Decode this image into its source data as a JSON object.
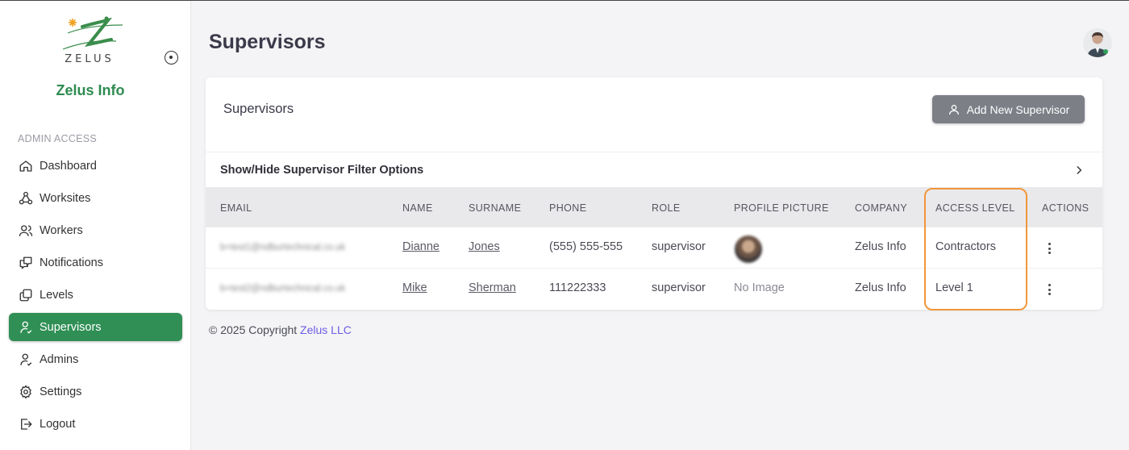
{
  "brand": {
    "logo_text": "ZELUS",
    "name": "Zelus Info"
  },
  "sidebar": {
    "section_label": "ADMIN ACCESS",
    "items": [
      {
        "label": "Dashboard",
        "icon": "home-icon"
      },
      {
        "label": "Worksites",
        "icon": "sitemap-icon"
      },
      {
        "label": "Workers",
        "icon": "users-icon"
      },
      {
        "label": "Notifications",
        "icon": "chat-icon"
      },
      {
        "label": "Levels",
        "icon": "copy-icon"
      },
      {
        "label": "Supervisors",
        "icon": "user-check-icon",
        "active": true
      },
      {
        "label": "Admins",
        "icon": "user-check-icon"
      },
      {
        "label": "Settings",
        "icon": "gear-icon"
      },
      {
        "label": "Logout",
        "icon": "logout-icon"
      }
    ]
  },
  "header": {
    "title": "Supervisors"
  },
  "card": {
    "title": "Supervisors",
    "add_button": "Add New Supervisor",
    "filter_toggle": "Show/Hide Supervisor Filter Options"
  },
  "table": {
    "columns": [
      "EMAIL",
      "NAME",
      "SURNAME",
      "PHONE",
      "ROLE",
      "PROFILE PICTURE",
      "COMPANY",
      "ACCESS LEVEL",
      "ACTIONS"
    ],
    "rows": [
      {
        "email": "b+test1@ndburtechnical.co.uk",
        "name": "Dianne",
        "surname": "Jones",
        "phone": "(555) 555-555",
        "role": "supervisor",
        "picture": "",
        "company": "Zelus Info",
        "access_level": "Contractors"
      },
      {
        "email": "b+test2@ndburtechnical.co.uk",
        "name": "Mike",
        "surname": "Sherman",
        "phone": "111222333",
        "role": "supervisor",
        "picture": "No Image",
        "company": "Zelus Info",
        "access_level": "Level 1"
      }
    ]
  },
  "footer": {
    "copyright": "© 2025 Copyright",
    "link": "Zelus LLC"
  },
  "colors": {
    "accent": "#2f8f55",
    "highlight": "#f1963a",
    "link": "#6c5ce7"
  }
}
